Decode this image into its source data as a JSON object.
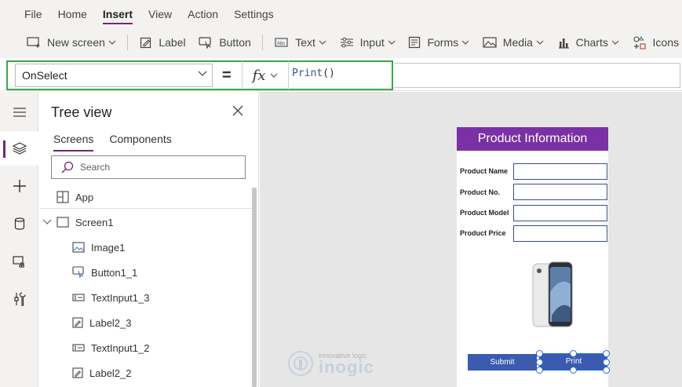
{
  "menu": {
    "items": [
      {
        "label": "File",
        "active": false
      },
      {
        "label": "Home",
        "active": false
      },
      {
        "label": "Insert",
        "active": true
      },
      {
        "label": "View",
        "active": false
      },
      {
        "label": "Action",
        "active": false
      },
      {
        "label": "Settings",
        "active": false
      }
    ]
  },
  "toolbar": {
    "new_screen": "New screen",
    "label": "Label",
    "button": "Button",
    "text": "Text",
    "input": "Input",
    "forms": "Forms",
    "media": "Media",
    "charts": "Charts",
    "icons": "Icons"
  },
  "formula_bar": {
    "property": "OnSelect",
    "equals": "=",
    "fx": "fx",
    "formula_fn": "Print",
    "formula_parens": "()"
  },
  "tree_view": {
    "title": "Tree view",
    "tabs": [
      "Screens",
      "Components"
    ],
    "active_tab": "Screens",
    "search_placeholder": "Search",
    "items": [
      {
        "label": "App",
        "icon": "app-icon",
        "level": 0
      },
      {
        "label": "Screen1",
        "icon": "screen-icon",
        "level": 0,
        "expanded": true
      },
      {
        "label": "Image1",
        "icon": "image-icon",
        "level": 1
      },
      {
        "label": "Button1_1",
        "icon": "button-icon",
        "level": 1
      },
      {
        "label": "TextInput1_3",
        "icon": "textinput-icon",
        "level": 1
      },
      {
        "label": "Label2_3",
        "icon": "label-icon",
        "level": 1
      },
      {
        "label": "TextInput1_2",
        "icon": "textinput-icon",
        "level": 1
      },
      {
        "label": "Label2_2",
        "icon": "label-icon",
        "level": 1
      }
    ]
  },
  "app_screen": {
    "header": "Product Information",
    "header_color": "#7a31a5",
    "fields": [
      "Product Name",
      "Product No.",
      "Product Model",
      "Product Price"
    ],
    "buttons": {
      "submit": "Submit",
      "print": "Print"
    },
    "button_color": "#3a5bb0"
  },
  "watermark": {
    "tagline": "innovative logic",
    "brand": "inogic"
  },
  "colors": {
    "accent": "#742774",
    "highlight": "#3aa64c",
    "selection": "#2a6ad6"
  }
}
